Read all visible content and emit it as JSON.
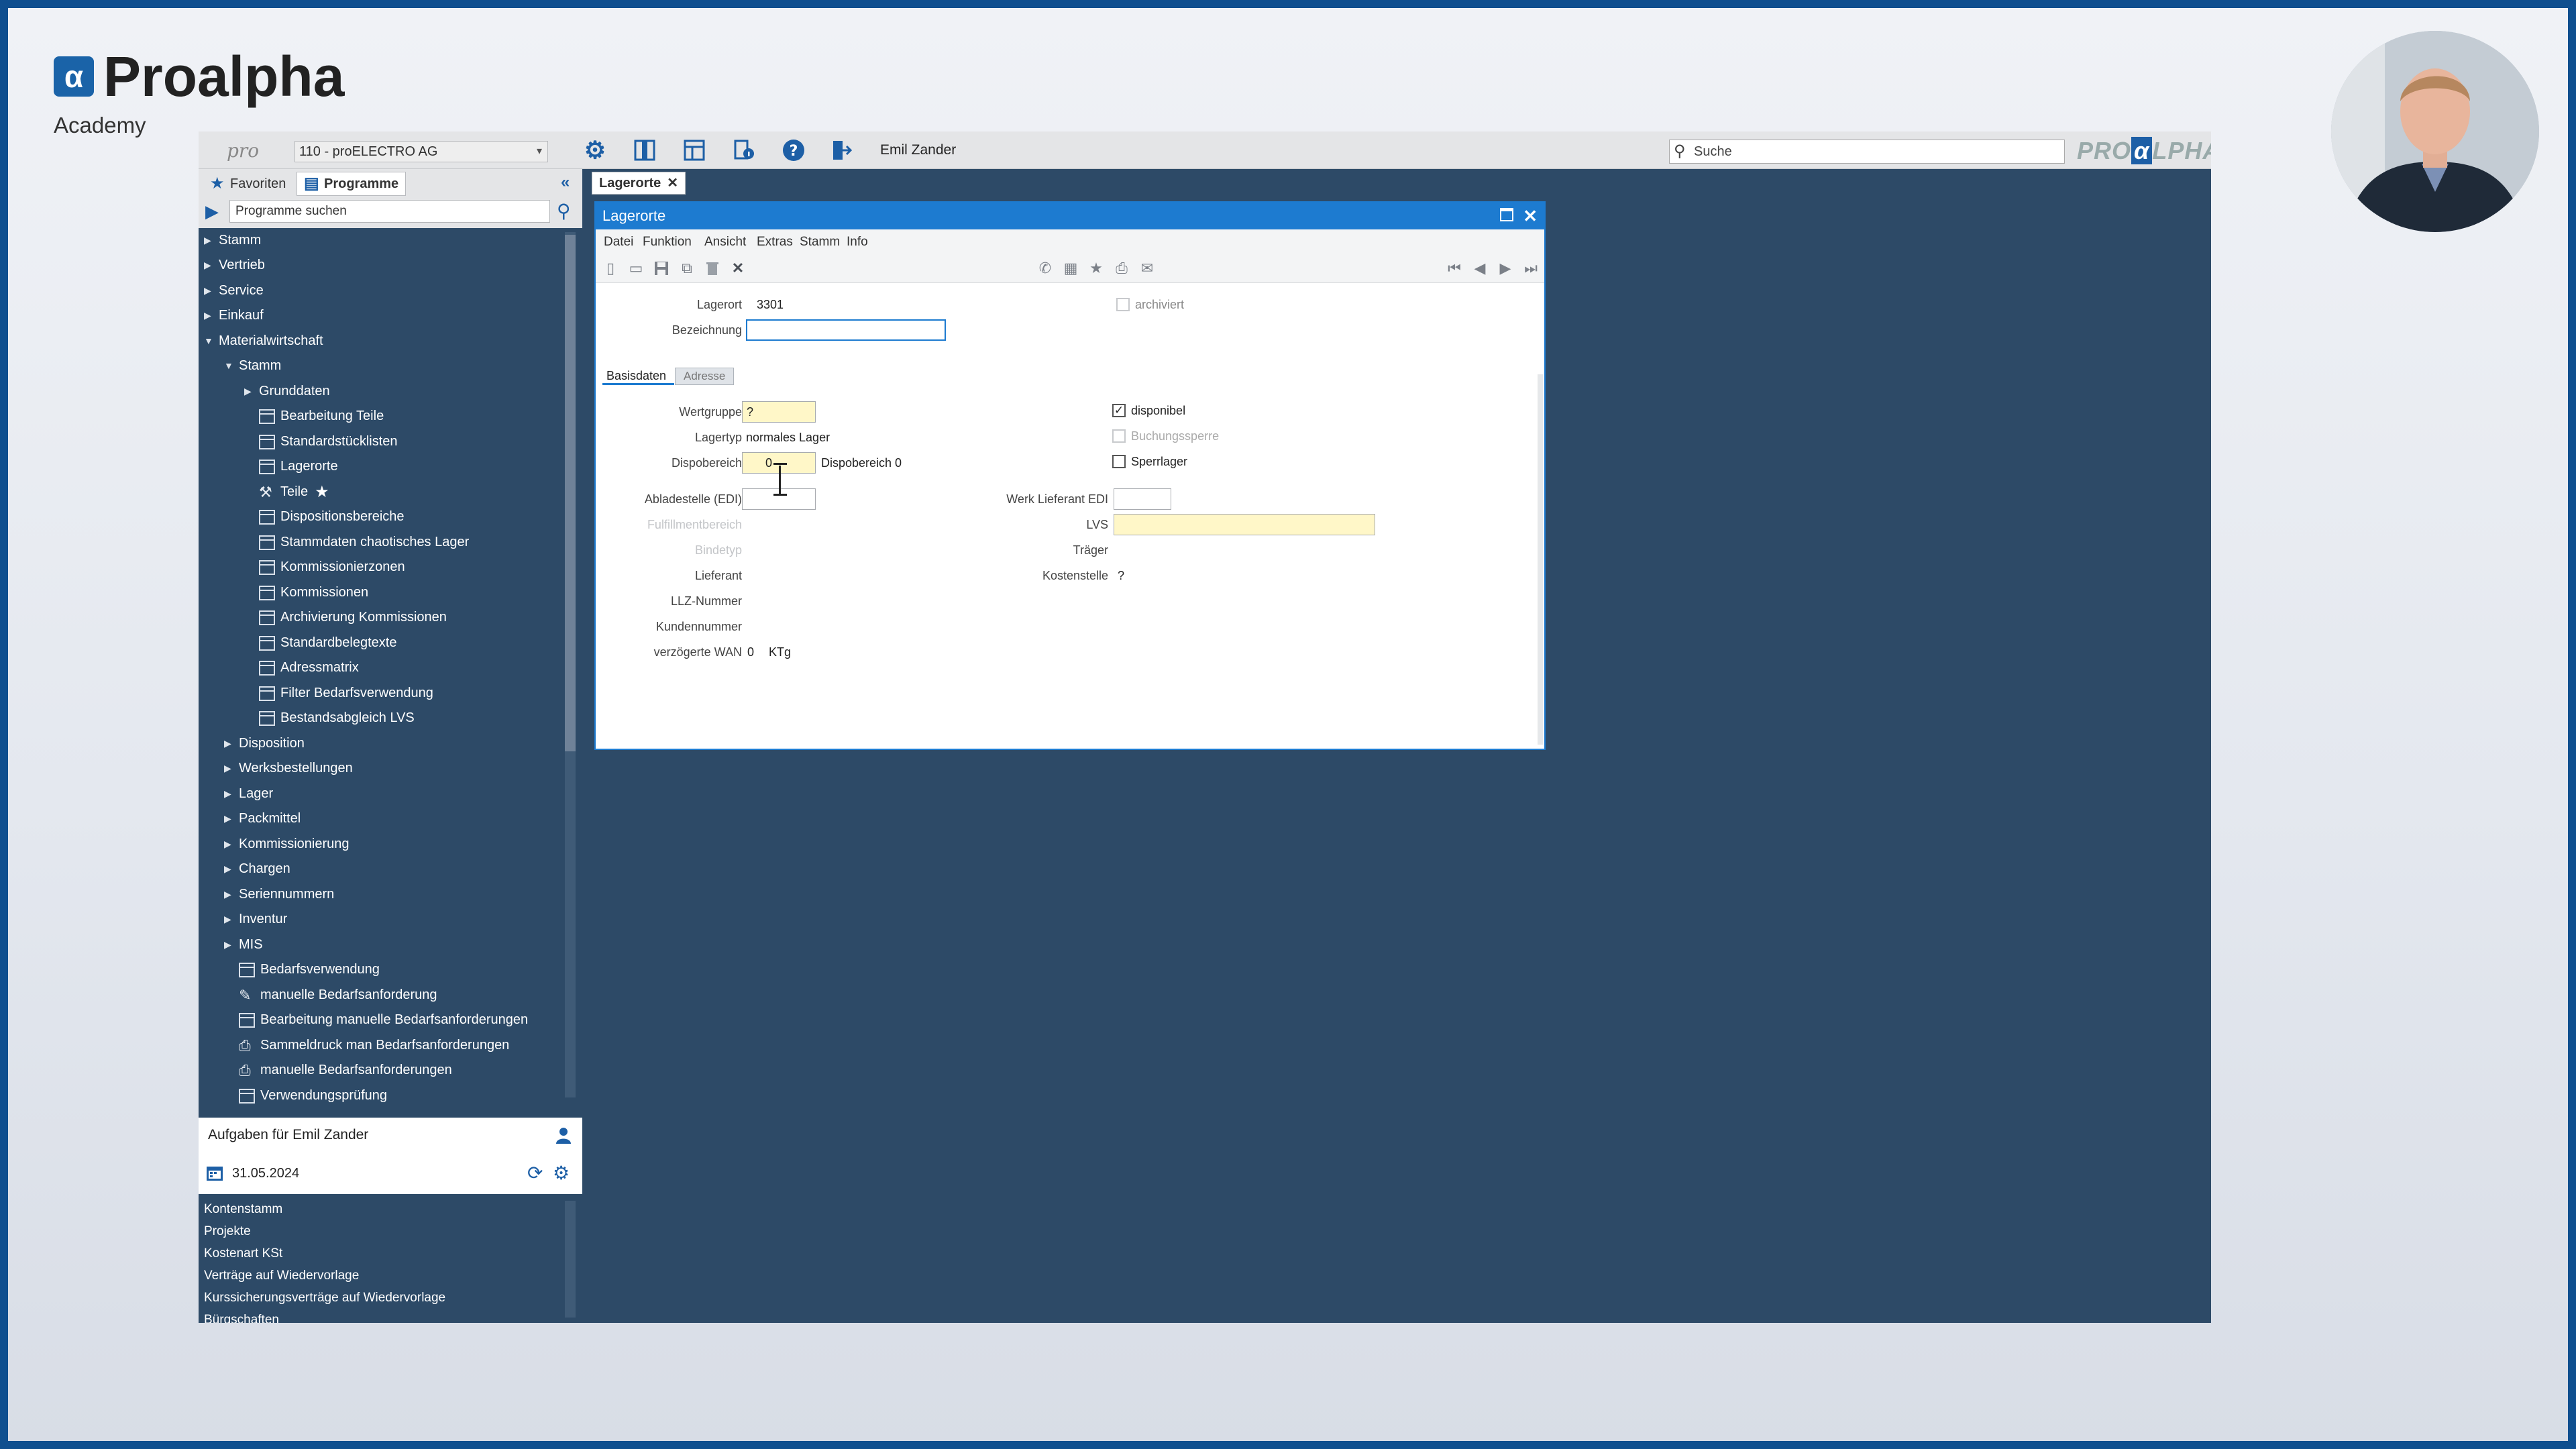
{
  "brand": {
    "name": "Proalpha",
    "subtitle": "Academy",
    "mark": "α"
  },
  "topbar": {
    "pro_logo": "pro",
    "company": "110 - proELECTRO AG",
    "user": "Emil Zander",
    "search_placeholder": "Suche",
    "brand_left": "PRO",
    "brand_mark": "α",
    "brand_right": "LPHA"
  },
  "sidebar": {
    "tabs": [
      {
        "label": "Favoriten"
      },
      {
        "label": "Programme"
      }
    ],
    "search_placeholder": "Programme suchen",
    "tree": [
      {
        "label": "Stamm",
        "arrow": "▶"
      },
      {
        "label": "Vertrieb",
        "arrow": "▶"
      },
      {
        "label": "Service",
        "arrow": "▶"
      },
      {
        "label": "Einkauf",
        "arrow": "▶"
      },
      {
        "label": "Materialwirtschaft",
        "arrow": "▼"
      },
      {
        "label": "Stamm",
        "arrow": "▼"
      },
      {
        "label": "Grunddaten",
        "arrow": "▶"
      },
      {
        "label": "Bearbeitung Teile"
      },
      {
        "label": "Standardstücklisten"
      },
      {
        "label": "Lagerorte"
      },
      {
        "label": "Teile",
        "star": "★"
      },
      {
        "label": "Dispositionsbereiche"
      },
      {
        "label": "Stammdaten chaotisches Lager"
      },
      {
        "label": "Kommissionierzonen"
      },
      {
        "label": "Kommissionen"
      },
      {
        "label": "Archivierung Kommissionen"
      },
      {
        "label": "Standardbelegtexte"
      },
      {
        "label": "Adressmatrix"
      },
      {
        "label": "Filter Bedarfsverwendung"
      },
      {
        "label": "Bestandsabgleich LVS"
      },
      {
        "label": "Disposition",
        "arrow": "▶"
      },
      {
        "label": "Werksbestellungen",
        "arrow": "▶"
      },
      {
        "label": "Lager",
        "arrow": "▶"
      },
      {
        "label": "Packmittel",
        "arrow": "▶"
      },
      {
        "label": "Kommissionierung",
        "arrow": "▶"
      },
      {
        "label": "Chargen",
        "arrow": "▶"
      },
      {
        "label": "Seriennummern",
        "arrow": "▶"
      },
      {
        "label": "Inventur",
        "arrow": "▶"
      },
      {
        "label": "MIS",
        "arrow": "▶"
      },
      {
        "label": "Bedarfsverwendung"
      },
      {
        "label": "manuelle Bedarfsanforderung"
      },
      {
        "label": "Bearbeitung manuelle Bedarfsanforderungen"
      },
      {
        "label": "Sammeldruck man Bedarfsanforderungen"
      },
      {
        "label": "manuelle Bedarfsanforderungen"
      },
      {
        "label": "Verwendungsprüfung"
      }
    ]
  },
  "tasks": {
    "title": "Aufgaben für Emil Zander",
    "date": "31.05.2024",
    "items": [
      "Kontenstamm",
      "Projekte",
      "Kostenart KSt",
      "Verträge auf Wiedervorlage",
      "Kurssicherungsverträge auf Wiedervorlage",
      "Bürgschaften"
    ]
  },
  "main_tab": {
    "label": "Lagerorte",
    "close": "✕"
  },
  "window": {
    "title": "Lagerorte",
    "menu": [
      "Datei",
      "Funktion",
      "Ansicht",
      "Extras",
      "Stamm",
      "Info"
    ]
  },
  "form": {
    "lagerort_label": "Lagerort",
    "lagerort_value": "3301",
    "archiviert_label": "archiviert",
    "bezeichnung_label": "Bezeichnung",
    "bezeichnung_value": "",
    "tabs": [
      "Basisdaten",
      "Adresse"
    ],
    "wertgruppe_label": "Wertgruppe",
    "wertgruppe_value": "?",
    "lagertyp_label": "Lagertyp",
    "lagertyp_value": "normales Lager",
    "dispobereich_label": "Dispobereich",
    "dispobereich_value": "0",
    "dispobereich_text": "Dispobereich 0",
    "abladestelle_label": "Abladestelle (EDI)",
    "abladestelle_value": "",
    "fremdbereich_label": "Fulfillmentbereich",
    "bindetyp_label": "Bindetyp",
    "lieferant_label": "Lieferant",
    "llz_label": "LLZ-Nummer",
    "kundennummer_label": "Kundennummer",
    "wan_label": "verzögerte WAN",
    "wan_value": "0",
    "wan_unit": "KTg",
    "disponibel_label": "disponibel",
    "disponibel_checked": "✓",
    "buchungssperre_label": "Buchungssperre",
    "sperrlager_label": "Sperrlager",
    "werk_lieferant_label": "Werk Lieferant EDI",
    "lvs_label": "LVS",
    "traeger_label": "Träger",
    "kostenstelle_label": "Kostenstelle",
    "kostenstelle_value": "?"
  }
}
